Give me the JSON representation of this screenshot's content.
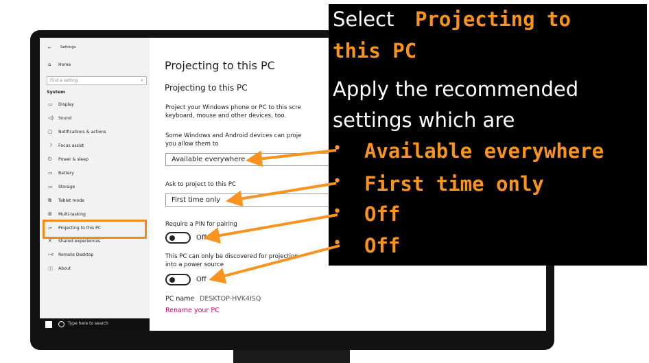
{
  "sidebar": {
    "back_label": "←",
    "app_title": "Settings",
    "home": "Home",
    "search_placeholder": "Find a setting",
    "section": "System",
    "items": [
      {
        "label": "Display",
        "icon": "▭"
      },
      {
        "label": "Sound",
        "icon": "◁)"
      },
      {
        "label": "Notifications & actions",
        "icon": "▢"
      },
      {
        "label": "Focus assist",
        "icon": "☽"
      },
      {
        "label": "Power & sleep",
        "icon": "⏻"
      },
      {
        "label": "Battery",
        "icon": "▭"
      },
      {
        "label": "Storage",
        "icon": "▭"
      },
      {
        "label": "Tablet mode",
        "icon": "⧉"
      },
      {
        "label": "Multi-tasking",
        "icon": "⊞"
      },
      {
        "label": "Projecting to this PC",
        "icon": "▱"
      },
      {
        "label": "Shared experiences",
        "icon": "✕"
      },
      {
        "label": "Remote Desktop",
        "icon": "›<"
      },
      {
        "label": "About",
        "icon": "ⓘ"
      }
    ],
    "taskbar_search": "Type here to search"
  },
  "main": {
    "title": "Projecting to this PC",
    "subtitle": "Projecting to this PC",
    "desc_line1": "Project your Windows phone or PC to this scre",
    "desc_line2": "keyboard, mouse and other devices, too.",
    "some_line1": "Some Windows and Android devices can proje",
    "some_line2": "you allow them to",
    "availability_value": "Available everywhere",
    "ask_label": "Ask to project to this PC",
    "ask_value": "First time only",
    "pin_label": "Require a PIN for pairing",
    "pin_state": "Off",
    "power_line1": "This PC can only be discovered for projection",
    "power_line2": "into a power source",
    "power_state": "Off",
    "pc_name_label": "PC name",
    "pc_name_value": "DESKTOP-HVK4ISQ",
    "rename_link": "Rename your PC"
  },
  "overlay": {
    "line1_white": "Select",
    "line1_orange": "Projecting to",
    "line2_orange": "this PC",
    "line3": "Apply the recommended",
    "line4": "settings which are",
    "bullet": "•",
    "bullets": [
      "Available everywhere",
      "First time only",
      "Off",
      "Off"
    ]
  },
  "colors": {
    "accent_orange": "#f7931e",
    "highlight_border": "#f08a14",
    "link_red": "#d4006a",
    "overlay_bg": "#000000"
  }
}
